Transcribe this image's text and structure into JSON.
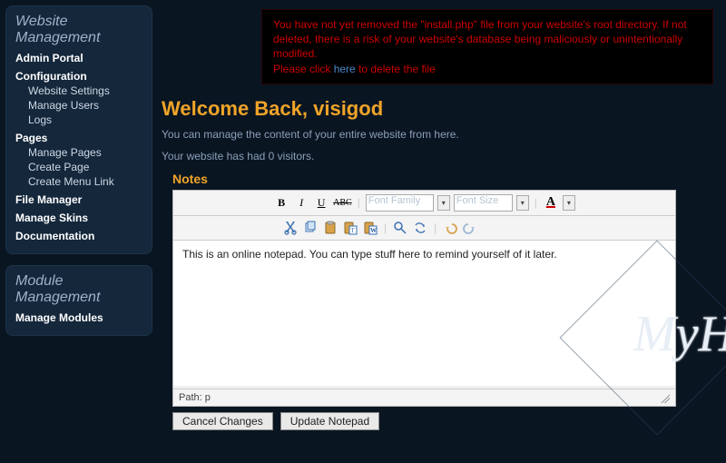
{
  "sidebar": {
    "box1_title": "Website Management",
    "items": [
      {
        "label": "Admin Portal",
        "bold": true
      },
      {
        "label": "Configuration",
        "bold": true,
        "subs": [
          "Website Settings",
          "Manage Users",
          "Logs"
        ]
      },
      {
        "label": "Pages",
        "bold": true,
        "subs": [
          "Manage Pages",
          "Create Page",
          "Create Menu Link"
        ]
      },
      {
        "label": "File Manager",
        "bold": true
      },
      {
        "label": "Manage Skins",
        "bold": true
      },
      {
        "label": "Documentation",
        "bold": true
      }
    ],
    "box2_title": "Module Management",
    "box2_item": "Manage Modules"
  },
  "warning": {
    "line1": "You have not yet removed the \"install.php\" file from your website's root directory. If not deleted, there is a risk of your website's database being maliciously or unintentionally modified.",
    "line2a": "Please click ",
    "link": "here",
    "line2b": " to delete the file"
  },
  "welcome": "Welcome Back, visigod",
  "sub1": "You can manage the content of your entire website from here.",
  "sub2": "Your website has had 0 visitors.",
  "notes_title": "Notes",
  "editor": {
    "font_family_label": "Font Family",
    "font_size_label": "Font Size",
    "body": "This is an online notepad. You can type stuff here to remind yourself of it later.",
    "path": "Path: p"
  },
  "buttons": {
    "cancel": "Cancel Changes",
    "update": "Update Notepad"
  }
}
